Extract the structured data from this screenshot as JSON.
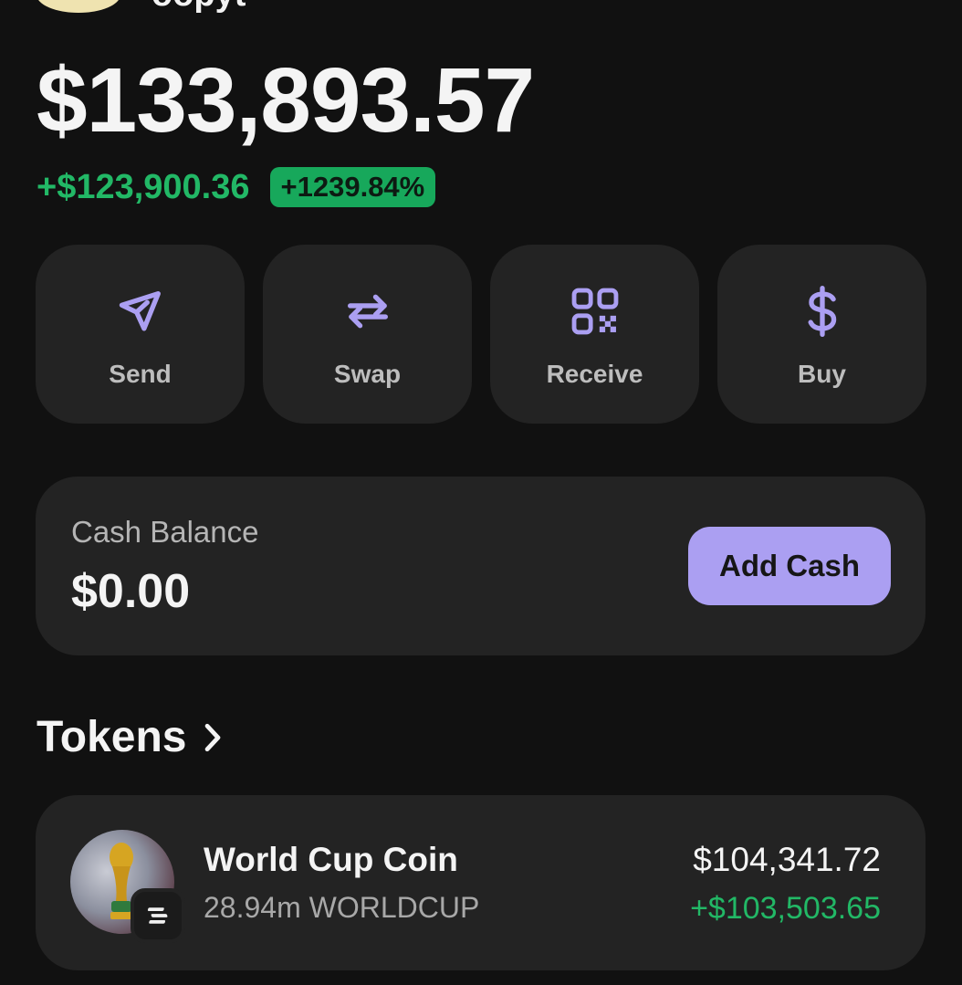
{
  "account": {
    "username": "oopyt"
  },
  "portfolio": {
    "balance": "$133,893.57",
    "change_amount": "+$123,900.36",
    "change_percent": "+1239.84%"
  },
  "actions": [
    {
      "label": "Send",
      "icon": "send-icon"
    },
    {
      "label": "Swap",
      "icon": "swap-icon"
    },
    {
      "label": "Receive",
      "icon": "qr-code-icon"
    },
    {
      "label": "Buy",
      "icon": "dollar-icon"
    }
  ],
  "cash": {
    "label": "Cash Balance",
    "value": "$0.00",
    "button_label": "Add Cash"
  },
  "tokens": {
    "title": "Tokens",
    "items": [
      {
        "name": "World Cup Coin",
        "holding": "28.94m WORLDCUP",
        "value": "$104,341.72",
        "change": "+$103,503.65",
        "icon": "world-cup-trophy-icon",
        "chain_icon": "solana-icon"
      }
    ]
  },
  "colors": {
    "background": "#111111",
    "card": "#232323",
    "accent": "#ab9ff2",
    "positive": "#22b866",
    "badge": "#17a85b"
  }
}
